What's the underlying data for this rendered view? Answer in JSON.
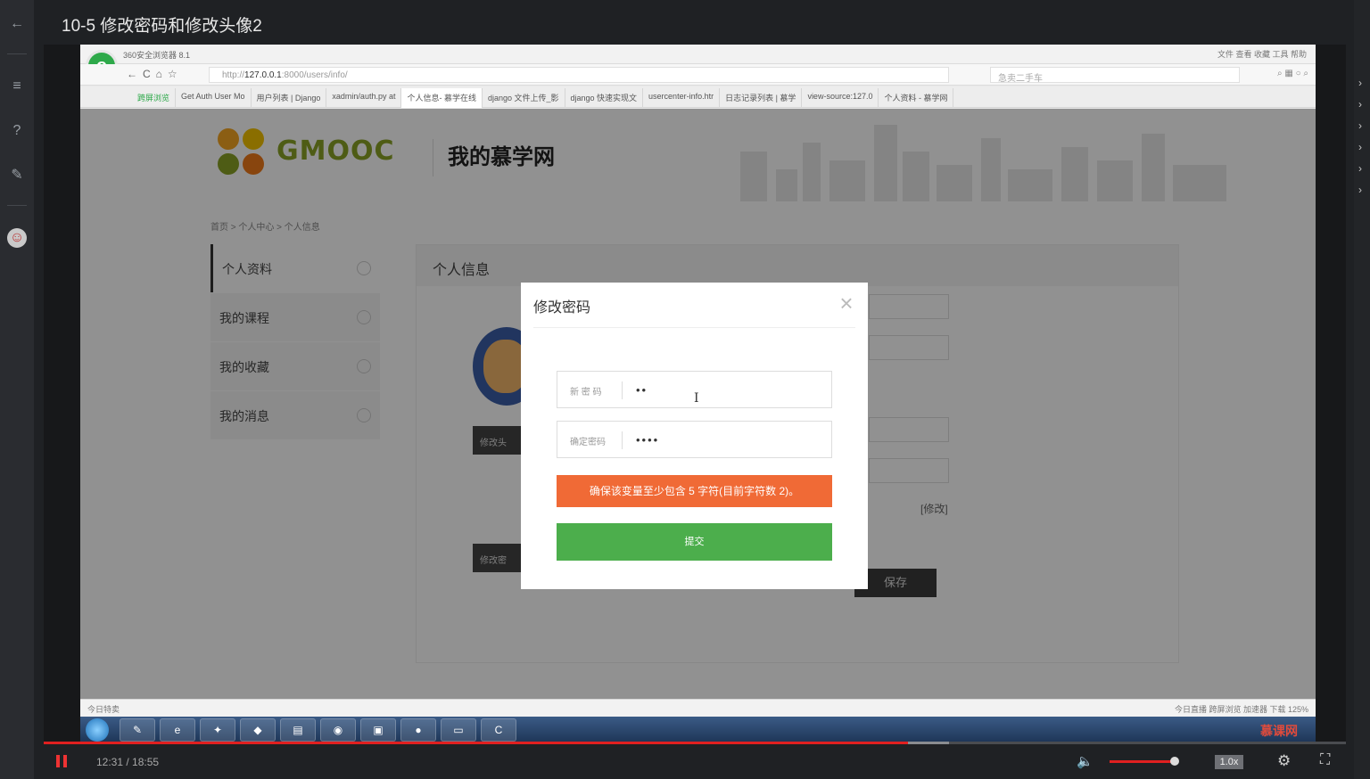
{
  "player": {
    "title": "10-5 修改密码和修改头像2",
    "time": "12:31 / 18:55",
    "progress": 0.664,
    "speed": "1.0x",
    "volume": 0.9
  },
  "browser": {
    "name": "360安全浏览器 8.1",
    "menu": "文件  查看  收藏  工具  帮助",
    "url_prefix": "http://",
    "url_host": "127.0.0.1",
    "url_rest": ":8000/users/info/",
    "search_placeholder": "急卖二手车",
    "tabs": [
      {
        "label": "跨屏浏览"
      },
      {
        "label": "Get Auth User Mo"
      },
      {
        "label": "用户列表 | Django"
      },
      {
        "label": "xadmin/auth.py at"
      },
      {
        "label": "个人信息- 慕学在线"
      },
      {
        "label": "django 文件上传_影"
      },
      {
        "label": "django 快速实现文"
      },
      {
        "label": "usercenter-info.htr"
      },
      {
        "label": "日志记录列表 | 慕学"
      },
      {
        "label": "view-source:127.0"
      },
      {
        "label": "个人资料 - 慕学网"
      }
    ],
    "status_left": "今日特卖",
    "status_right": "今日直播   跨屏浏览   加速器   下载   125%"
  },
  "site": {
    "logo_text": "GMOOC",
    "subtitle": "我的慕学网",
    "breadcrumb": "首页 > 个人中心 > 个人信息",
    "sidebar": [
      {
        "label": "个人资料"
      },
      {
        "label": "我的课程"
      },
      {
        "label": "我的收藏"
      },
      {
        "label": "我的消息"
      }
    ],
    "panel_title": "个人信息",
    "btn_avatar": "修改头",
    "btn_pwd": "修改密",
    "edit_link": "[修改]",
    "save": "保存"
  },
  "modal": {
    "title": "修改密码",
    "close": "×",
    "new_pwd_label": "新 密 码",
    "new_pwd_value": "••",
    "confirm_label": "确定密码",
    "confirm_value": "••••",
    "error": "确保该变量至少包含 5 字符(目前字符数 2)。",
    "submit": "提交"
  },
  "taskbar": {
    "watermark": "慕课网"
  },
  "colors": {
    "error": "#f06a36",
    "submit": "#4cae4c",
    "progress": "#e02020"
  }
}
